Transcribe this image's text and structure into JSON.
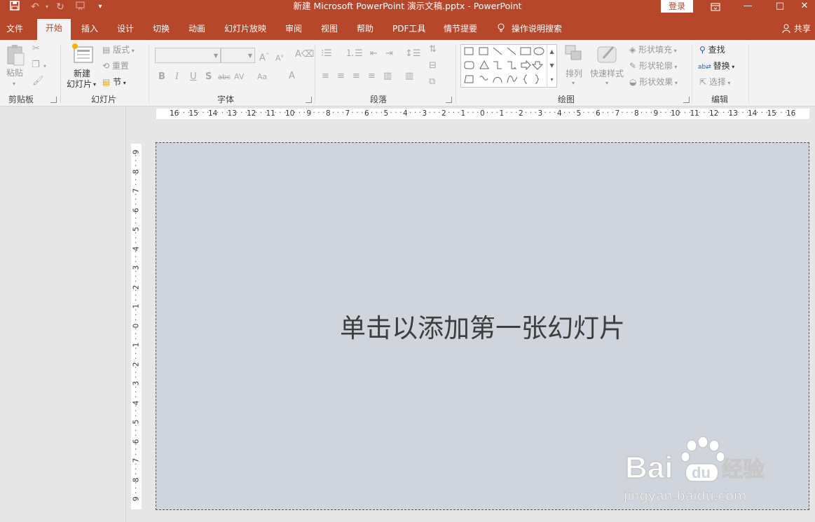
{
  "title_bar": {
    "title": "新建 Microsoft PowerPoint 演示文稿.pptx  -  PowerPoint",
    "login": "登录",
    "quick_access": [
      "save-icon",
      "undo-icon",
      "redo-icon",
      "start-from-beginning-icon",
      "customize-icon"
    ],
    "window_controls": [
      "ribbon-display-options-icon",
      "minimize-icon",
      "maximize-icon",
      "close-icon"
    ]
  },
  "tabs": [
    "文件",
    "开始",
    "插入",
    "设计",
    "切换",
    "动画",
    "幻灯片放映",
    "审阅",
    "视图",
    "帮助",
    "PDF工具",
    "情节提要"
  ],
  "active_tab": "开始",
  "tell_me": "操作说明搜索",
  "share": "共享",
  "ribbon": {
    "clipboard": {
      "label": "剪贴板",
      "paste": "粘贴"
    },
    "slides": {
      "label": "幻灯片",
      "new_slide_line1": "新建",
      "new_slide_line2": "幻灯片",
      "layout": "版式",
      "reset": "重置",
      "section": "节"
    },
    "font": {
      "label": "字体",
      "bold": "B",
      "italic": "I",
      "underline": "U",
      "shadow": "S",
      "strike": "abc",
      "spacing": "AV",
      "case": "Aa",
      "color": "A"
    },
    "paragraph": {
      "label": "段落"
    },
    "drawing": {
      "label": "绘图",
      "arrange": "排列",
      "quick_styles": "快速样式",
      "shape_fill": "形状填充",
      "shape_outline": "形状轮廓",
      "shape_effects": "形状效果"
    },
    "editing": {
      "label": "编辑",
      "find": "查找",
      "replace": "替换",
      "select": "选择"
    }
  },
  "ruler": {
    "horizontal": [
      "16",
      "15",
      "14",
      "13",
      "12",
      "11",
      "10",
      "9",
      "8",
      "7",
      "6",
      "5",
      "4",
      "3",
      "2",
      "1",
      "0",
      "1",
      "2",
      "3",
      "4",
      "5",
      "6",
      "7",
      "8",
      "9",
      "10",
      "11",
      "12",
      "13",
      "14",
      "15",
      "16"
    ],
    "vertical": [
      "9",
      "8",
      "7",
      "6",
      "5",
      "4",
      "3",
      "2",
      "1",
      "0",
      "1",
      "2",
      "3",
      "4",
      "5",
      "6",
      "7",
      "8",
      "9"
    ]
  },
  "slide": {
    "placeholder": "单击以添加第一张幻灯片"
  },
  "watermark": {
    "brand": "Bai du 经验",
    "url": "jingyan.baidu.com"
  }
}
